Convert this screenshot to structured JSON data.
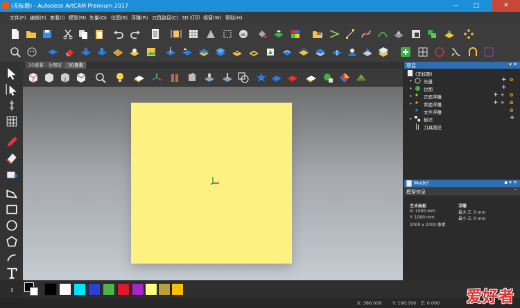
{
  "window": {
    "title": "(无标题) - Autodesk ArtCAM Premium 2017",
    "minimize": "—",
    "maximize": "□",
    "close": "✕"
  },
  "menu": [
    {
      "label": "文件(F)"
    },
    {
      "label": "编辑(E)"
    },
    {
      "label": "查看(I)"
    },
    {
      "label": "模型(M)"
    },
    {
      "label": "矢量(O)"
    },
    {
      "label": "位图(B)"
    },
    {
      "label": "浮雕(R)"
    },
    {
      "label": "刀具路径(C)"
    },
    {
      "label": "3D 打印"
    },
    {
      "label": "视窗(W)"
    },
    {
      "label": "帮助(H)"
    }
  ],
  "view": {
    "tabs": [
      {
        "label": "2D查看 - 位图层"
      },
      {
        "label": "3D查看"
      }
    ]
  },
  "project_panel": {
    "title": "项目",
    "tree": [
      {
        "label": "(无标题)"
      },
      {
        "label": "矢量"
      },
      {
        "label": "位图"
      },
      {
        "label": "正面浮雕"
      },
      {
        "label": "背面浮雕"
      },
      {
        "label": "文件浮雕"
      },
      {
        "label": "板坯"
      },
      {
        "label": "刀具路径"
      }
    ]
  },
  "model_panel": {
    "title": "Model",
    "section": "模型信息",
    "art_size_label": "艺术画板",
    "x": "X: 1000 mm",
    "y": "Y: 1000 mm",
    "pixels": "2000 x 2000 像素",
    "relief_label": "浮雕",
    "max_z": "最大 Z: 0 mm",
    "min_z": "最小 Z: 0 mm"
  },
  "palette": {
    "colors": [
      "#000000",
      "#ffffff",
      "#00e5ff",
      "#2c3fd8",
      "#4cb648",
      "#e0182a",
      "#a825c8",
      "#ffff80",
      "#b8a238",
      "#ffbf00"
    ]
  },
  "status": {
    "x": "X: 386.000",
    "y": "Y: 106.000",
    "z": "Z: 0.000"
  },
  "watermark": "爱好者"
}
